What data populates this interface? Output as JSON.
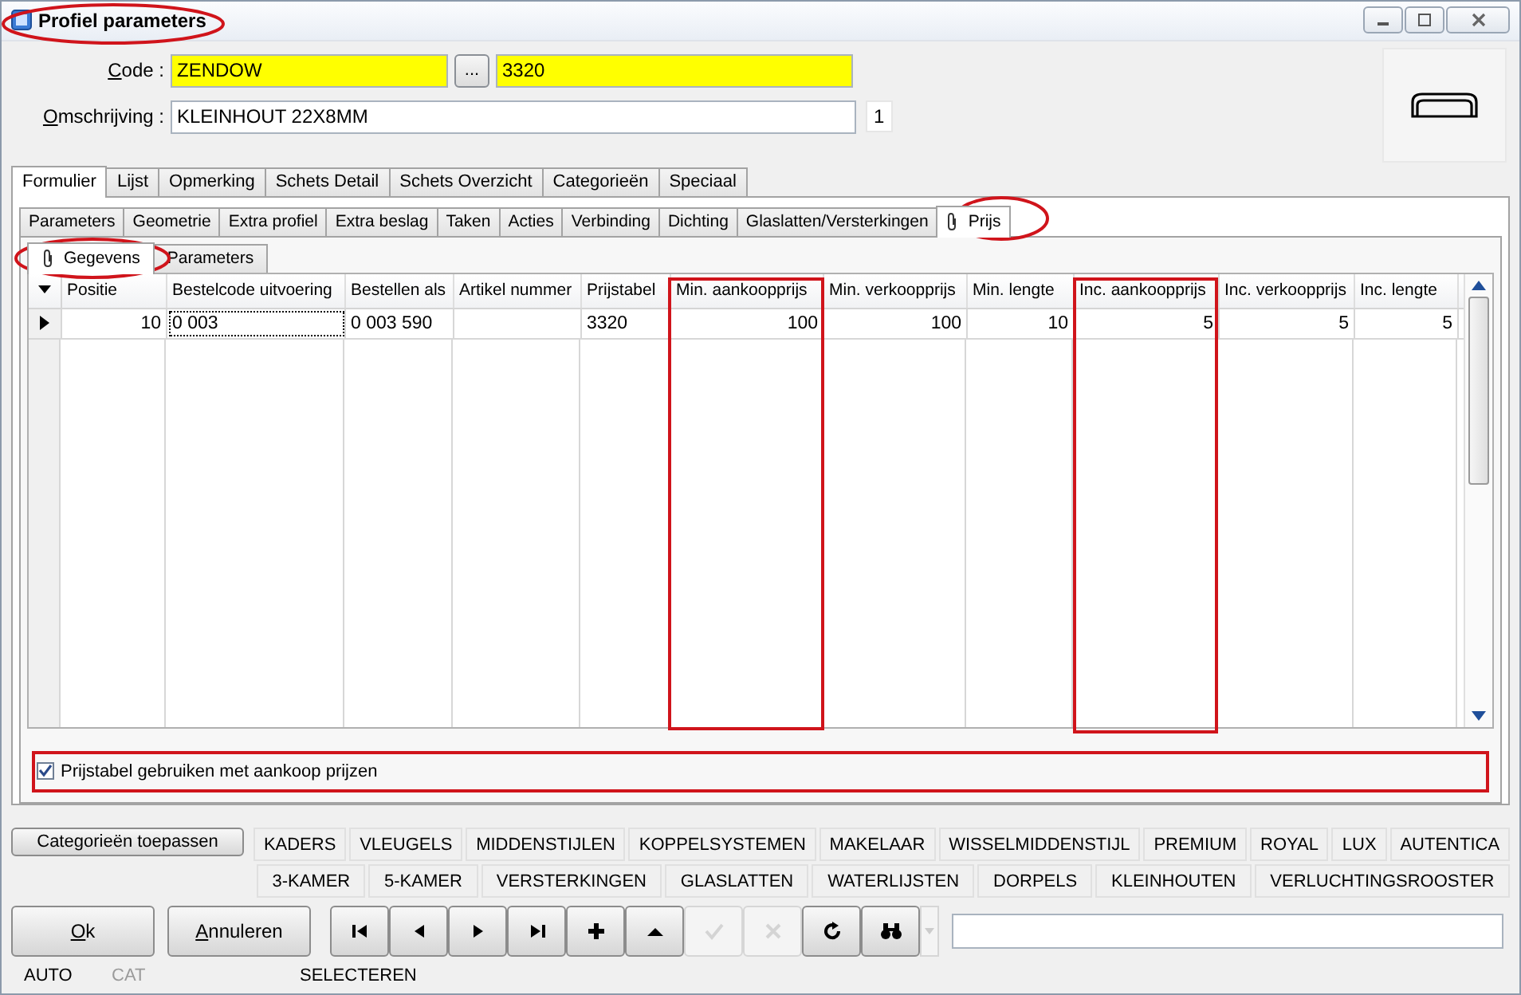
{
  "window": {
    "title": "Profiel parameters"
  },
  "code": {
    "label": "Code :",
    "value": "ZENDOW",
    "browse": "...",
    "value2": "3320"
  },
  "description": {
    "label": "Omschrijving :",
    "value": "KLEINHOUT 22X8MM",
    "count": "1"
  },
  "tabs": [
    {
      "label": "Formulier",
      "selected": true
    },
    {
      "label": "Lijst",
      "selected": false
    },
    {
      "label": "Opmerking",
      "selected": false
    },
    {
      "label": "Schets Detail",
      "selected": false
    },
    {
      "label": "Schets Overzicht",
      "selected": false
    },
    {
      "label": "Categorieën",
      "selected": false
    },
    {
      "label": "Speciaal",
      "selected": false
    }
  ],
  "subtabs": [
    {
      "label": "Parameters",
      "selected": false,
      "clip": false
    },
    {
      "label": "Geometrie",
      "selected": false,
      "clip": false
    },
    {
      "label": "Extra profiel",
      "selected": false,
      "clip": false
    },
    {
      "label": "Extra beslag",
      "selected": false,
      "clip": false
    },
    {
      "label": "Taken",
      "selected": false,
      "clip": false
    },
    {
      "label": "Acties",
      "selected": false,
      "clip": false
    },
    {
      "label": "Verbinding",
      "selected": false,
      "clip": false
    },
    {
      "label": "Dichting",
      "selected": false,
      "clip": false
    },
    {
      "label": "Glaslatten/Versterkingen",
      "selected": false,
      "clip": false
    },
    {
      "label": "Prijs",
      "selected": true,
      "clip": true
    }
  ],
  "innertabs": [
    {
      "label": "Gegevens",
      "selected": true,
      "clip": true
    },
    {
      "label": "Parameters",
      "selected": false,
      "clip": false
    }
  ],
  "table": {
    "columns": [
      "Positie",
      "Bestelcode uitvoering",
      "Bestellen als",
      "Artikel nummer",
      "Prijstabel",
      "Min. aankoopprijs",
      "Min. verkoopprijs",
      "Min. lengte",
      "Inc. aankoopprijs",
      "Inc. verkoopprijs",
      "Inc. lengte"
    ],
    "rows": [
      {
        "current": true,
        "cells": [
          "10",
          "0 003",
          "0 003 590",
          "",
          "3320",
          "100",
          "100",
          "10",
          "5",
          "5",
          "5"
        ]
      }
    ]
  },
  "checkbox": {
    "label": "Prijstabel gebruiken met aankoop prijzen",
    "checked": true
  },
  "apply_button": "Categorieën toepassen",
  "categories_row_1": [
    "KADERS",
    "VLEUGELS",
    "MIDDENSTIJLEN",
    "KOPPELSYSTEMEN",
    "MAKELAAR",
    "WISSELMIDDENSTIJL",
    "PREMIUM",
    "ROYAL",
    "LUX",
    "AUTENTICA"
  ],
  "categories_row_2": [
    "3-KAMER",
    "5-KAMER",
    "VERSTERKINGEN",
    "GLASLATTEN",
    "WATERLIJSTEN",
    "DORPELS",
    "KLEINHOUTEN",
    "VERLUCHTINGSROOSTER"
  ],
  "buttons": [
    {
      "label": "Ok"
    },
    {
      "label": "Annuleren"
    }
  ],
  "nav": [
    {
      "kind": "first",
      "disabled": false
    },
    {
      "kind": "prev",
      "disabled": false
    },
    {
      "kind": "next",
      "disabled": false
    },
    {
      "kind": "last",
      "disabled": false
    },
    {
      "kind": "add",
      "disabled": false
    },
    {
      "kind": "up",
      "disabled": false
    },
    {
      "kind": "confirm",
      "disabled": true
    },
    {
      "kind": "cancel",
      "disabled": true
    },
    {
      "kind": "refresh",
      "disabled": false
    },
    {
      "kind": "find",
      "disabled": false
    }
  ],
  "status": [
    {
      "label": "AUTO",
      "disabled": false
    },
    {
      "label": "CAT",
      "disabled": true
    },
    {
      "label": "SELECTEREN",
      "disabled": false
    }
  ]
}
